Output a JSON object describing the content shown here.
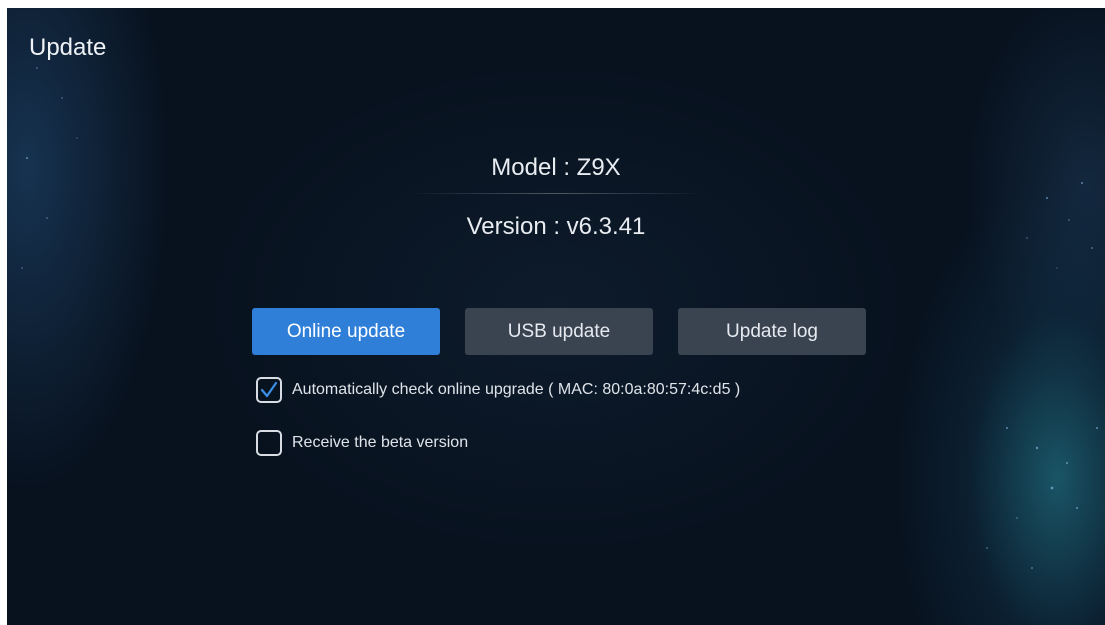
{
  "header": {
    "title": "Update"
  },
  "device": {
    "model_text": "Model : Z9X",
    "version_text": "Version : v6.3.41"
  },
  "actions": {
    "online_update_label": "Online update",
    "usb_update_label": "USB update",
    "update_log_label": "Update log",
    "focused": "online_update"
  },
  "options": {
    "auto_check": {
      "label": "Automatically check online upgrade ( MAC: 80:0a:80:57:4c:d5 )",
      "checked": true
    },
    "beta": {
      "label": "Receive the beta version",
      "checked": false
    }
  },
  "colors": {
    "background": "#08121f",
    "button": "#3a4350",
    "button_focused": "#2f7fd9",
    "check_accent": "#3b8fe8",
    "text": "#e6eaf0"
  },
  "icons": {
    "checkmark": "check-icon"
  }
}
